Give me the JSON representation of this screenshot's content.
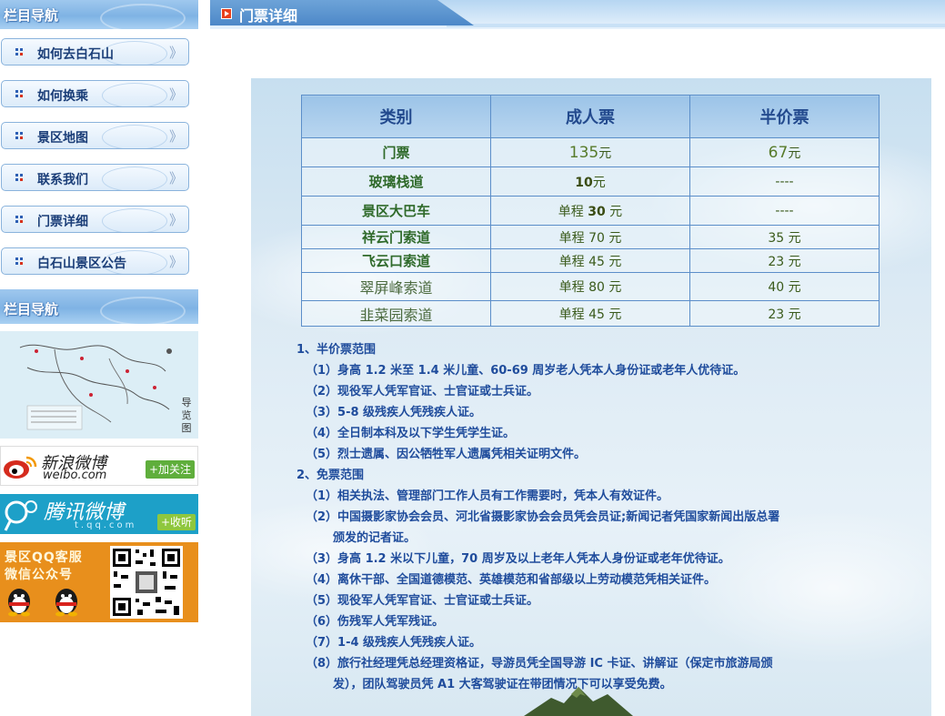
{
  "sidebar": {
    "nav_title": "栏目导航",
    "nav_items": [
      {
        "label": "如何去白石山",
        "arrow": "》"
      },
      {
        "label": "如何换乘",
        "arrow": "》"
      },
      {
        "label": "景区地图",
        "arrow": "》"
      },
      {
        "label": "联系我们",
        "arrow": "》"
      },
      {
        "label": "门票详细",
        "arrow": "》"
      },
      {
        "label": "白石山景区公告",
        "arrow": "》"
      }
    ],
    "nav_title_2": "栏目导航",
    "map_side_text": "导览图",
    "weibo": {
      "name": "新浪微博",
      "domain": "weibo.com",
      "follow": "+加关注"
    },
    "tqq": {
      "name": "腾讯微博",
      "domain": "t.qq.com",
      "listen": "+收听"
    },
    "qq": {
      "line1": "景区QQ客服",
      "line2": "微信公众号"
    }
  },
  "main": {
    "title": "门票详细",
    "table": {
      "headers": [
        "类别",
        "成人票",
        "半价票"
      ],
      "rows": [
        {
          "category": "门票",
          "adult_pre": "",
          "adult_num": "135",
          "adult_unit": "元",
          "half_num": "67",
          "half_unit": "元"
        },
        {
          "category": "玻璃栈道",
          "adult_pre": "",
          "adult_num": "10",
          "adult_unit": "元",
          "half_num": "----",
          "half_unit": ""
        },
        {
          "category": "景区大巴车",
          "adult_pre": "单程 ",
          "adult_num": "30",
          "adult_unit": " 元",
          "half_num": "----",
          "half_unit": ""
        },
        {
          "category": "祥云门索道",
          "adult_pre": "单程 ",
          "adult_num": "70",
          "adult_unit": " 元",
          "half_num": "35",
          "half_unit": " 元"
        },
        {
          "category": "飞云口索道",
          "adult_pre": "单程 ",
          "adult_num": "45",
          "adult_unit": " 元",
          "half_num": "23",
          "half_unit": " 元"
        },
        {
          "category": "翠屏峰索道",
          "adult_pre": "单程  ",
          "adult_num": "80",
          "adult_unit": " 元",
          "half_num": "40",
          "half_unit": " 元"
        },
        {
          "category": "韭菜园索道",
          "adult_pre": "单程 ",
          "adult_num": "45",
          "adult_unit": " 元",
          "half_num": "23",
          "half_unit": " 元"
        }
      ]
    },
    "notes": [
      {
        "kind": "sec",
        "text": "1、半价票范围"
      },
      {
        "kind": "item",
        "text": "（1）身高 1.2 米至 1.4 米儿童、60-69 周岁老人凭本人身份证或老年人优待证。"
      },
      {
        "kind": "item",
        "text": "（2）现役军人凭军官证、士官证或士兵证。"
      },
      {
        "kind": "item",
        "text": "（3）5-8 级残疾人凭残疾人证。"
      },
      {
        "kind": "item",
        "text": "（4）全日制本科及以下学生凭学生证。"
      },
      {
        "kind": "item",
        "text": "（5）烈士遗属、因公牺牲军人遗属凭相关证明文件。"
      },
      {
        "kind": "sec",
        "text": "2、免票范围"
      },
      {
        "kind": "item",
        "text": "（1）相关执法、管理部门工作人员有工作需要时，凭本人有效证件。"
      },
      {
        "kind": "item",
        "text": "（2）中国摄影家协会会员、河北省摄影家协会会员凭会员证;新闻记者凭国家新闻出版总署"
      },
      {
        "kind": "cont",
        "text": "颁发的记者证。"
      },
      {
        "kind": "item",
        "text": "（3）身高 1.2 米以下儿童，70 周岁及以上老年人凭本人身份证或老年优待证。"
      },
      {
        "kind": "item",
        "text": "（4）离休干部、全国道德模范、英雄模范和省部级以上劳动模范凭相关证件。"
      },
      {
        "kind": "item",
        "text": "（5）现役军人凭军官证、士官证或士兵证。"
      },
      {
        "kind": "item",
        "text": "（6）伤残军人凭军残证。"
      },
      {
        "kind": "item",
        "text": "（7）1-4 级残疾人凭残疾人证。"
      },
      {
        "kind": "item",
        "text": "（8）旅行社经理凭总经理资格证，导游员凭全国导游 IC 卡证、讲解证（保定市旅游局颁"
      },
      {
        "kind": "cont",
        "text": "发），团队驾驶员凭 A1 大客驾驶证在带团情况下可以享受免费。"
      }
    ]
  }
}
